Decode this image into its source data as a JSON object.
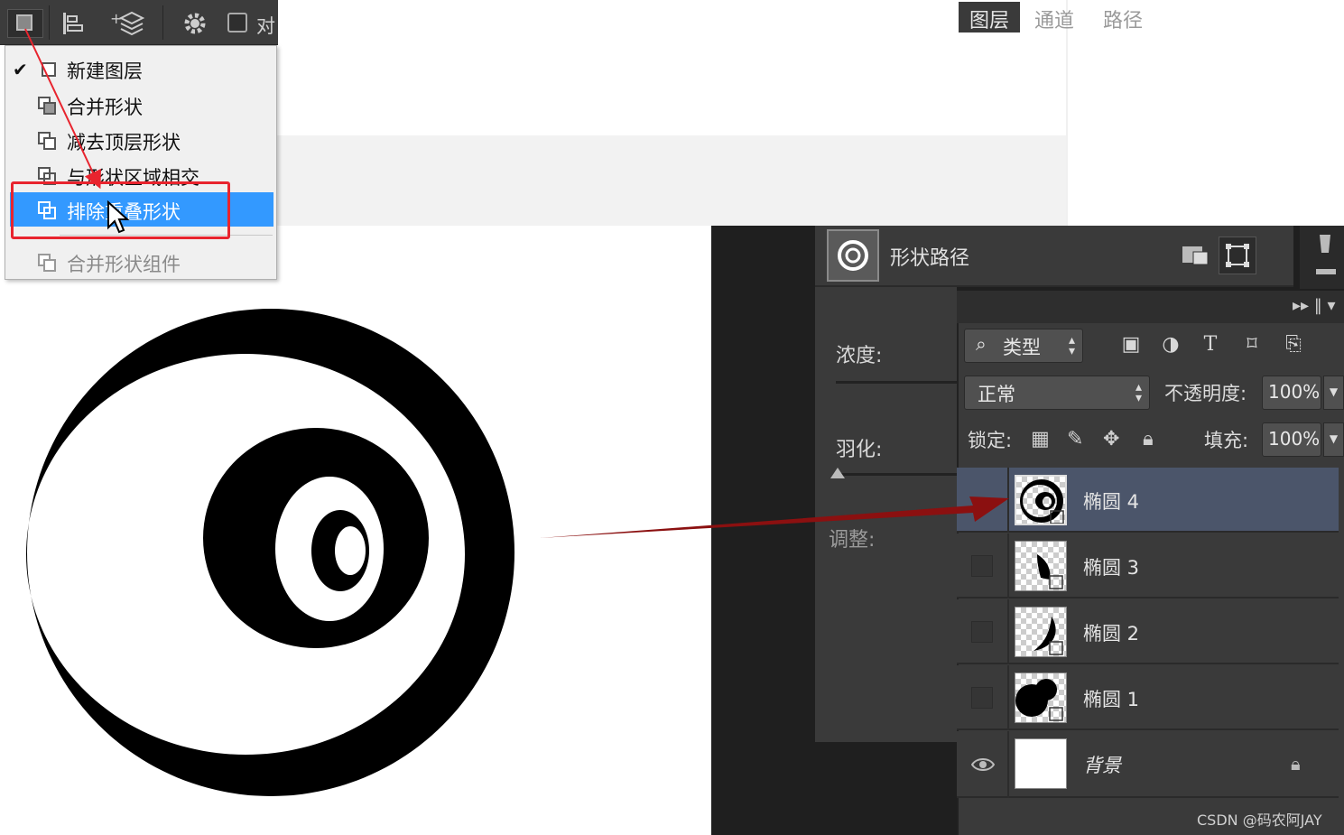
{
  "toolbar": {
    "label_partial": "对",
    "buttons": [
      "shape-combine",
      "path-alignment",
      "path-arrangement",
      "settings"
    ]
  },
  "menu": {
    "items": [
      {
        "label": "新建图层",
        "checked": true
      },
      {
        "label": "合并形状"
      },
      {
        "label": "减去顶层形状"
      },
      {
        "label": "与形状区域相交"
      },
      {
        "label": "排除重叠形状",
        "highlighted": true
      },
      {
        "label": "合并形状组件",
        "disabled": true
      }
    ],
    "highlight_color": "#3399ff"
  },
  "properties": {
    "title": "形状路径",
    "density_label": "浓度:",
    "feather_label": "羽化:",
    "adjust_label": "调整:"
  },
  "layers_panel": {
    "tabs": [
      "图层",
      "通道",
      "路径"
    ],
    "filter_label": "类型",
    "blend_mode": "正常",
    "opacity_label": "不透明度:",
    "opacity_value": "100%",
    "lock_label": "锁定:",
    "fill_label": "填充:",
    "fill_value": "100%",
    "layers": [
      {
        "name": "椭圆 4",
        "selected": true
      },
      {
        "name": "椭圆 3"
      },
      {
        "name": "椭圆 2"
      },
      {
        "name": "椭圆 1"
      },
      {
        "name": "背景",
        "locked": true,
        "visible": true
      }
    ]
  },
  "watermark": "CSDN @码农阿JAY",
  "colors": {
    "annotation_red": "#e8242e",
    "arrow_dark_red": "#8b1010"
  }
}
